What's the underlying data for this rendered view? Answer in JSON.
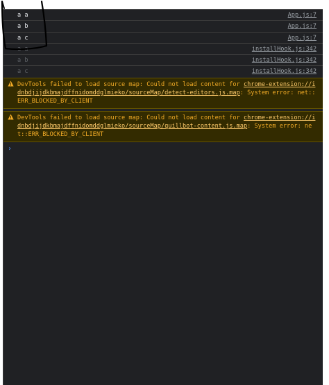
{
  "logs": [
    {
      "message": "a a",
      "source": "App.js:7",
      "dim": false
    },
    {
      "message": "a b",
      "source": "App.js:7",
      "dim": false
    },
    {
      "message": "a c",
      "source": "App.js:7",
      "dim": false
    },
    {
      "message": "a a",
      "source": "installHook.js:342",
      "dim": true
    },
    {
      "message": "a b",
      "source": "installHook.js:342",
      "dim": true
    },
    {
      "message": "a c",
      "source": "installHook.js:342",
      "dim": true
    }
  ],
  "warnings": [
    {
      "prefix": "DevTools failed to load source map: Could not load content for ",
      "url": "chrome-extension://idnbdjijdkbmajdffnidomddglmieko/sourceMap/detect-editors.js.map",
      "suffix": ": System error: net::ERR_BLOCKED_BY_CLIENT"
    },
    {
      "prefix": "DevTools failed to load source map: Could not load content for ",
      "url": "chrome-extension://idnbdjijdkbmajdffnidomddglmieko/sourceMap/quillbot-content.js.map",
      "suffix": ": System error: net::ERR_BLOCKED_BY_CLIENT"
    }
  ],
  "prompt_symbol": "›",
  "colors": {
    "background": "#202124",
    "warning_text": "#f2ab26",
    "warning_background": "#332b00",
    "prompt": "#4b8df8"
  }
}
